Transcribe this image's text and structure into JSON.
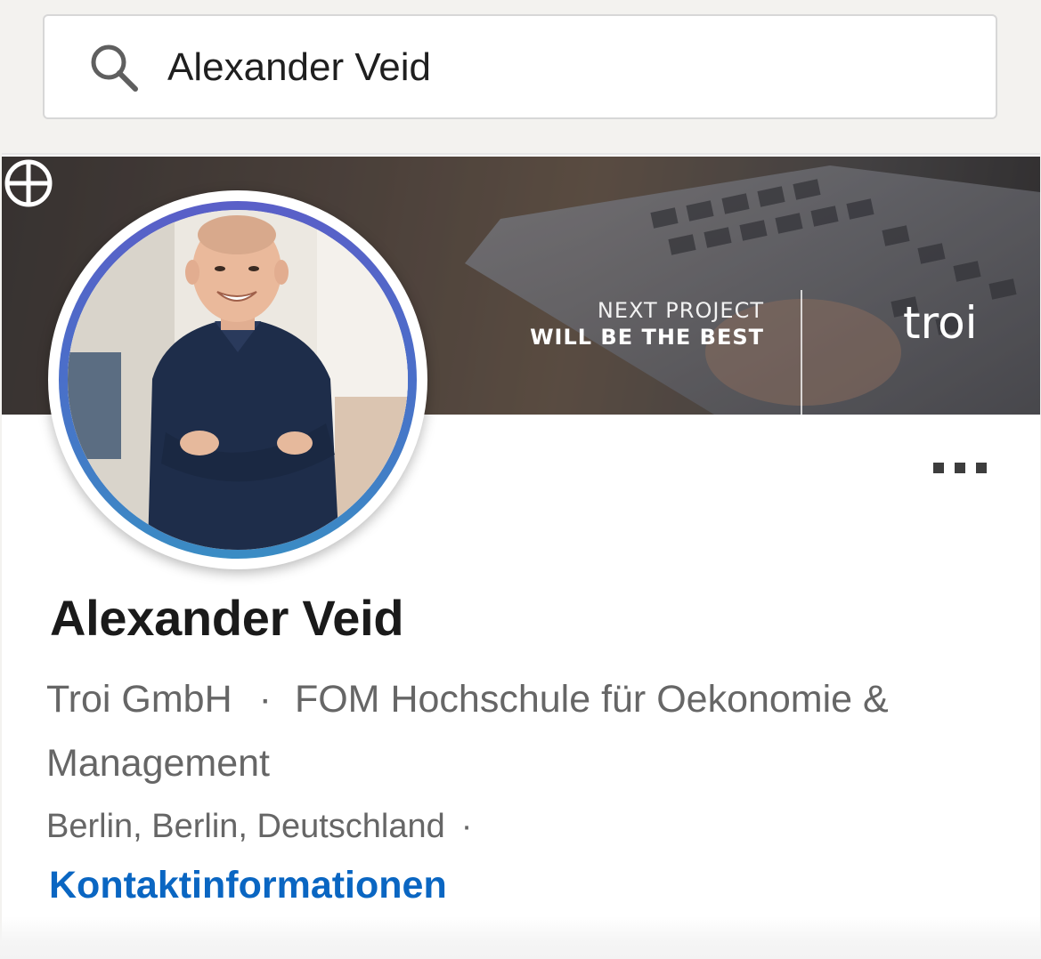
{
  "search": {
    "value": "Alexander Veid",
    "icon": "search-icon"
  },
  "banner": {
    "slogan_line1": "NEXT PROJECT",
    "slogan_line2": "WILL BE THE BEST",
    "brand": "troi"
  },
  "profile": {
    "name": "Alexander Veid",
    "company": "Troi GmbH",
    "separator": "·",
    "school": "FOM Hochschule für Oekonomie & Management",
    "location": "Berlin, Berlin, Deutschland",
    "location_separator": "·",
    "contact_link": "Kontaktinformationen",
    "more_icon": "more-horizontal-icon"
  },
  "colors": {
    "link": "#0a66c2",
    "avatar_ring_top": "#5a5fc8",
    "avatar_ring_bottom": "#3a8cc4",
    "muted_text": "#666666"
  }
}
